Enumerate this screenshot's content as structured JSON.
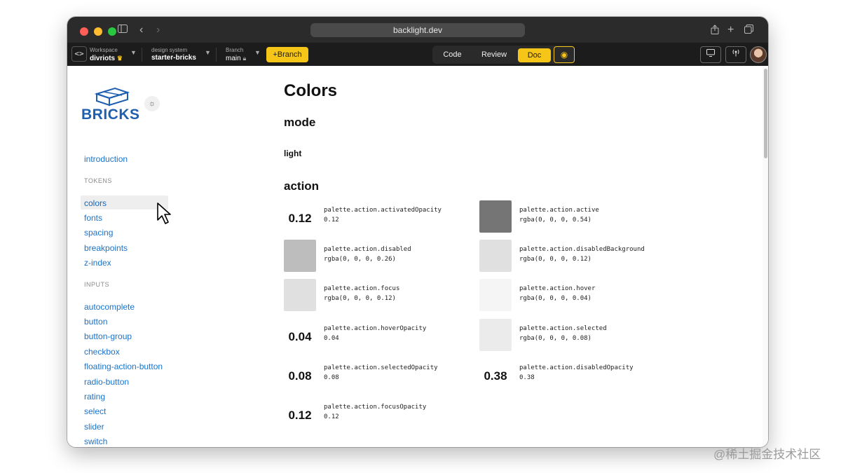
{
  "browser": {
    "url": "backlight.dev",
    "colors": {
      "close": "#ff5f57",
      "minimize": "#febc2e",
      "maximize": "#28c840"
    }
  },
  "appbar": {
    "workspace_label": "Workspace",
    "workspace_value": "divriots",
    "design_system_label": "design system",
    "design_system_value": "starter-bricks",
    "branch_label": "Branch",
    "branch_value": "main",
    "branch_button": "+Branch",
    "tabs": [
      {
        "label": "Code",
        "active": false
      },
      {
        "label": "Review",
        "active": false
      },
      {
        "label": "Doc",
        "active": true
      }
    ],
    "accent": "#f5c518"
  },
  "sidebar": {
    "brand": "BRICKS",
    "brand_color": "#1f5fb0",
    "intro": "introduction",
    "tokens_header": "TOKENS",
    "tokens": [
      "colors",
      "fonts",
      "spacing",
      "breakpoints",
      "z-index"
    ],
    "active_item": "colors",
    "inputs_header": "INPUTS",
    "inputs": [
      "autocomplete",
      "button",
      "button-group",
      "checkbox",
      "floating-action-button",
      "radio-button",
      "rating",
      "select",
      "slider",
      "switch"
    ]
  },
  "main": {
    "title": "Colors",
    "mode_heading": "mode",
    "mode_value": "light",
    "action_heading": "action",
    "tokens": [
      {
        "kind": "opacity",
        "display": "0.12",
        "name": "palette.action.activatedOpacity",
        "value": "0.12"
      },
      {
        "kind": "swatch",
        "color": "rgba(0, 0, 0, 0.54)",
        "name": "palette.action.active",
        "value": "rgba(0, 0, 0, 0.54)"
      },
      {
        "kind": "swatch",
        "color": "rgba(0, 0, 0, 0.26)",
        "name": "palette.action.disabled",
        "value": "rgba(0, 0, 0, 0.26)"
      },
      {
        "kind": "swatch",
        "color": "rgba(0, 0, 0, 0.12)",
        "name": "palette.action.disabledBackground",
        "value": "rgba(0, 0, 0, 0.12)"
      },
      {
        "kind": "swatch",
        "color": "rgba(0, 0, 0, 0.12)",
        "name": "palette.action.focus",
        "value": "rgba(0, 0, 0, 0.12)"
      },
      {
        "kind": "swatch",
        "color": "rgba(0, 0, 0, 0.04)",
        "name": "palette.action.hover",
        "value": "rgba(0, 0, 0, 0.04)"
      },
      {
        "kind": "opacity",
        "display": "0.04",
        "name": "palette.action.hoverOpacity",
        "value": "0.04"
      },
      {
        "kind": "swatch",
        "color": "rgba(0, 0, 0, 0.08)",
        "name": "palette.action.selected",
        "value": "rgba(0, 0, 0, 0.08)"
      },
      {
        "kind": "opacity",
        "display": "0.08",
        "name": "palette.action.selectedOpacity",
        "value": "0.08"
      },
      {
        "kind": "opacity",
        "display": "0.38",
        "name": "palette.action.disabledOpacity",
        "value": "0.38"
      },
      {
        "kind": "opacity",
        "display": "0.12",
        "name": "palette.action.focusOpacity",
        "value": "0.12"
      }
    ]
  },
  "watermark": "@稀土掘金技术社区"
}
